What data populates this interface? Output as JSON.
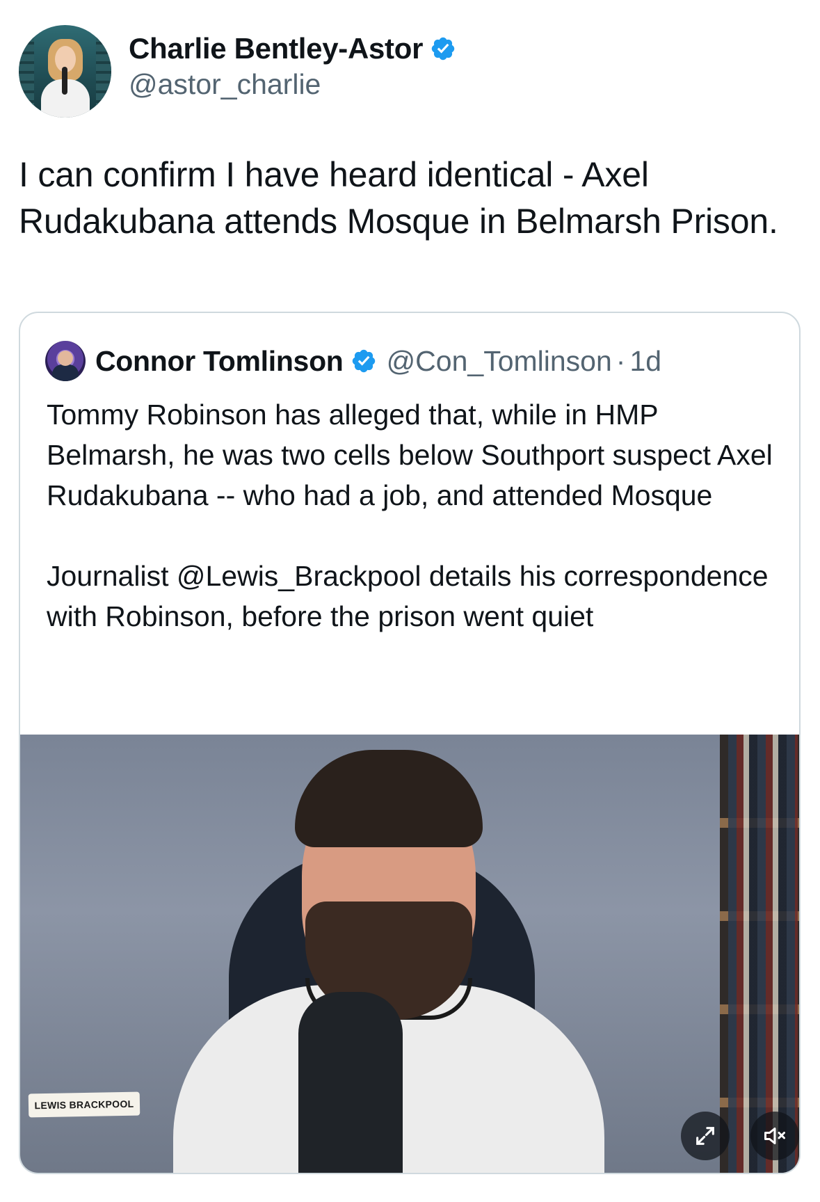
{
  "author": {
    "name": "Charlie Bentley-Astor",
    "handle": "@astor_charlie",
    "verified": true
  },
  "tweet": {
    "text": "I can confirm I have heard identical - Axel Rudakubana attends Mosque in Belmarsh Prison."
  },
  "quoted_tweet": {
    "name": "Connor Tomlinson",
    "handle": "@Con_Tomlinson",
    "separator": "·",
    "time": "1d",
    "verified": true,
    "paragraph_1": "Tommy Robinson has alleged that, while in HMP Belmarsh, he was two cells below Southport suspect Axel Rudakubana -- who had a job, and attended Mosque",
    "paragraph_2": "Journalist @Lewis_Brackpool details his correspondence with Robinson, before the prison went quiet",
    "media": {
      "type": "video",
      "overlay_label": "LEWIS BRACKPOOL",
      "controls": [
        "expand-icon",
        "mute-icon"
      ]
    }
  },
  "colors": {
    "verified_blue": "#1d9bf0",
    "secondary_text": "#536471",
    "border": "#cfd9de"
  }
}
